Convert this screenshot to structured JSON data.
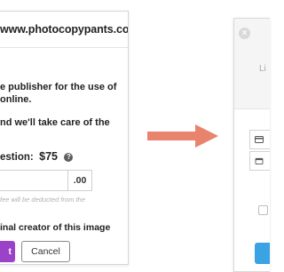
{
  "left_dialog": {
    "site_url": "www.photocopypants.com",
    "line1": "e publisher for the use of",
    "line2": "online.",
    "line3": "nd we'll take care of the",
    "price_label": "estion:",
    "price_value": "$75",
    "help_icon": "?",
    "cents": ".00",
    "fee_note": "fee will be deducted from the",
    "creator_line": "inal creator of this image",
    "submit_label": "t",
    "cancel_label": "Cancel",
    "accent_color": "#9a42c8"
  },
  "arrow": {
    "color": "#e8836e",
    "direction": "right"
  },
  "right_dialog": {
    "close_glyph": "×",
    "title": "Li",
    "icons": [
      "credit-card-icon",
      "calendar-icon"
    ],
    "button_color": "#3aa3e3"
  }
}
